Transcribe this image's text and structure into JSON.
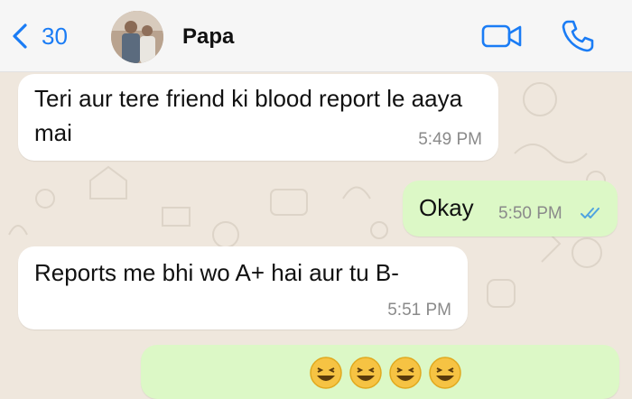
{
  "header": {
    "back_count": "30",
    "contact_name": "Papa",
    "accent_color": "#1a7cf5"
  },
  "messages": [
    {
      "direction": "incoming",
      "text": "Teri aur tere friend ki blood report le aaya mai",
      "time": "5:49 PM"
    },
    {
      "direction": "outgoing",
      "text": "Okay",
      "time": "5:50 PM",
      "status": "read"
    },
    {
      "direction": "incoming",
      "text": "Reports me bhi wo A+ hai aur tu B-",
      "time": "5:51 PM"
    },
    {
      "direction": "outgoing",
      "text": "",
      "emojis": [
        "laughing-emoji",
        "laughing-emoji",
        "laughing-emoji",
        "laughing-emoji"
      ]
    }
  ],
  "icons": [
    "chevron-left-icon",
    "video-call-icon",
    "phone-icon",
    "double-check-icon"
  ]
}
